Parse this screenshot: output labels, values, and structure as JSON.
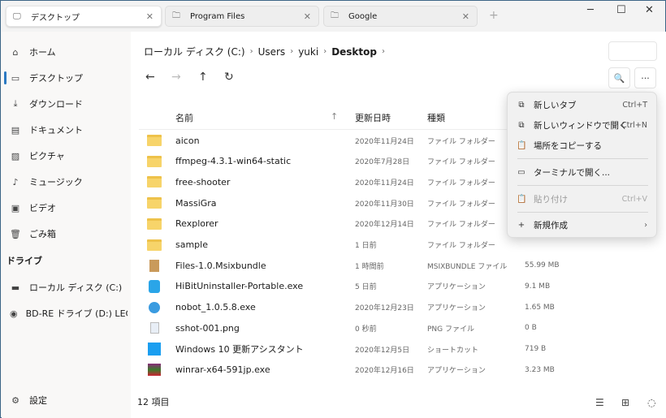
{
  "tabs": [
    {
      "label": "デスクトップ",
      "icon": "desktop-icon"
    },
    {
      "label": "Program  Files",
      "icon": "folder-icon"
    },
    {
      "label": "Google",
      "icon": "folder-icon"
    }
  ],
  "sidebar": {
    "items": [
      {
        "label": "ホーム",
        "icon": "⌂"
      },
      {
        "label": "デスクトップ",
        "icon": "▭"
      },
      {
        "label": "ダウンロード",
        "icon": "⤓"
      },
      {
        "label": "ドキュメント",
        "icon": "▤"
      },
      {
        "label": "ピクチャ",
        "icon": "▨"
      },
      {
        "label": "ミュージック",
        "icon": "♪"
      },
      {
        "label": "ビデオ",
        "icon": "▣"
      },
      {
        "label": "ごみ箱",
        "icon": "🗑"
      }
    ],
    "drives_header": "ドライブ",
    "drives": [
      {
        "label": "ローカル ディスク (C:)",
        "icon": "▬"
      },
      {
        "label": "BD-RE ドライブ (D:) LEON",
        "icon": "◉"
      }
    ],
    "settings": "設定"
  },
  "breadcrumb": [
    "ローカル ディスク (C:)",
    "Users",
    "yuki",
    "Desktop"
  ],
  "columns": {
    "name": "名前",
    "date": "更新日時",
    "type": "種類"
  },
  "files": [
    {
      "name": "aicon",
      "date": "2020年11月24日",
      "type": "ファイル フォルダー",
      "size": "",
      "kind": "folder"
    },
    {
      "name": "ffmpeg-4.3.1-win64-static",
      "date": "2020年7月28日",
      "type": "ファイル フォルダー",
      "size": "",
      "kind": "folder"
    },
    {
      "name": "free-shooter",
      "date": "2020年11月24日",
      "type": "ファイル フォルダー",
      "size": "",
      "kind": "folder"
    },
    {
      "name": "MassiGra",
      "date": "2020年11月30日",
      "type": "ファイル フォルダー",
      "size": "",
      "kind": "folder"
    },
    {
      "name": "Rexplorer",
      "date": "2020年12月14日",
      "type": "ファイル フォルダー",
      "size": "",
      "kind": "folder"
    },
    {
      "name": "sample",
      "date": "1 日前",
      "type": "ファイル フォルダー",
      "size": "",
      "kind": "folder"
    },
    {
      "name": "Files-1.0.Msixbundle",
      "date": "1 時間前",
      "type": "MSIXBUNDLE ファイル",
      "size": "55.99 MB",
      "kind": "package"
    },
    {
      "name": "HiBitUninstaller-Portable.exe",
      "date": "5 日前",
      "type": "アプリケーション",
      "size": "9.1 MB",
      "kind": "app-blue"
    },
    {
      "name": "nobot_1.0.5.8.exe",
      "date": "2020年12月23日",
      "type": "アプリケーション",
      "size": "1.65 MB",
      "kind": "app-round"
    },
    {
      "name": "sshot-001.png",
      "date": "0 秒前",
      "type": "PNG ファイル",
      "size": "0 B",
      "kind": "image"
    },
    {
      "name": "Windows 10 更新アシスタント",
      "date": "2020年12月5日",
      "type": "ショートカット",
      "size": "719 B",
      "kind": "windows-shortcut"
    },
    {
      "name": "winrar-x64-591jp.exe",
      "date": "2020年12月16日",
      "type": "アプリケーション",
      "size": "3.23 MB",
      "kind": "winrar"
    }
  ],
  "status": "12 項目",
  "context_menu": [
    {
      "label": "新しいタブ",
      "shortcut": "Ctrl+T",
      "icon": "⧉"
    },
    {
      "label": "新しいウィンドウで開く",
      "shortcut": "Ctrl+N",
      "icon": "⧉"
    },
    {
      "label": "場所をコピーする",
      "shortcut": "",
      "icon": "📋"
    },
    {
      "label": "ターミナルで開く...",
      "shortcut": "",
      "icon": "▭"
    },
    {
      "label": "貼り付け",
      "shortcut": "Ctrl+V",
      "icon": "📋",
      "disabled": true
    },
    {
      "label": "新規作成",
      "shortcut": "",
      "icon": "+"
    }
  ],
  "colors": {
    "accent": "#2b79c2",
    "folder": "#f7d46a"
  }
}
